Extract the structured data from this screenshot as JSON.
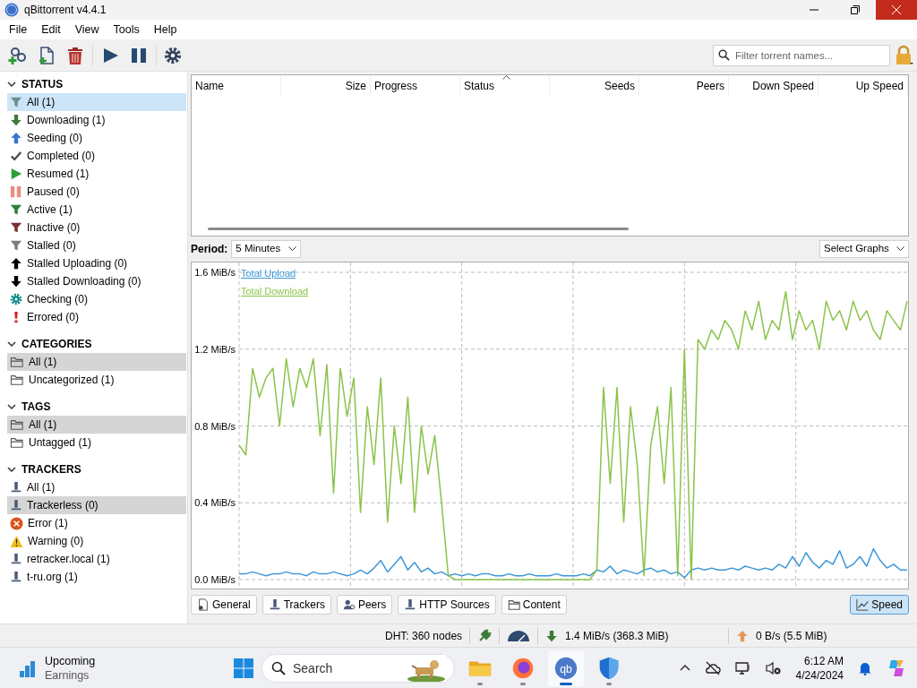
{
  "window": {
    "title": "qBittorrent v4.4.1",
    "close_hovered": true
  },
  "menu": [
    "File",
    "Edit",
    "View",
    "Tools",
    "Help"
  ],
  "filter": {
    "placeholder": "Filter torrent names..."
  },
  "sidebar": [
    {
      "title": "STATUS",
      "expanded": true,
      "focused": true,
      "items": [
        {
          "kind": "all",
          "label": "All (1)",
          "selected": true
        },
        {
          "kind": "downloading",
          "label": "Downloading (1)",
          "selected": false
        },
        {
          "kind": "seeding",
          "label": "Seeding (0)",
          "selected": false
        },
        {
          "kind": "completed",
          "label": "Completed (0)",
          "selected": false
        },
        {
          "kind": "resumed",
          "label": "Resumed (1)",
          "selected": false
        },
        {
          "kind": "paused",
          "label": "Paused (0)",
          "selected": false
        },
        {
          "kind": "active",
          "label": "Active (1)",
          "selected": false
        },
        {
          "kind": "inactive",
          "label": "Inactive (0)",
          "selected": false
        },
        {
          "kind": "stalled",
          "label": "Stalled (0)",
          "selected": false
        },
        {
          "kind": "stalled-up",
          "label": "Stalled Uploading (0)",
          "selected": false
        },
        {
          "kind": "stalled-down",
          "label": "Stalled Downloading (0)",
          "selected": false
        },
        {
          "kind": "checking",
          "label": "Checking (0)",
          "selected": false
        },
        {
          "kind": "errored",
          "label": "Errored (0)",
          "selected": false
        }
      ]
    },
    {
      "title": "CATEGORIES",
      "expanded": true,
      "focused": false,
      "items": [
        {
          "kind": "folder",
          "label": "All (1)",
          "selected": true
        },
        {
          "kind": "folder",
          "label": "Uncategorized (1)",
          "selected": false
        }
      ]
    },
    {
      "title": "TAGS",
      "expanded": true,
      "focused": false,
      "items": [
        {
          "kind": "folder",
          "label": "All (1)",
          "selected": true
        },
        {
          "kind": "folder",
          "label": "Untagged (1)",
          "selected": false
        }
      ]
    },
    {
      "title": "TRACKERS",
      "expanded": true,
      "focused": false,
      "items": [
        {
          "kind": "tracker",
          "label": "All (1)",
          "selected": false
        },
        {
          "kind": "tracker",
          "label": "Trackerless (0)",
          "selected": true
        },
        {
          "kind": "error",
          "label": "Error (1)",
          "selected": false
        },
        {
          "kind": "warning",
          "label": "Warning (0)",
          "selected": false
        },
        {
          "kind": "tracker",
          "label": "retracker.local (1)",
          "selected": false
        },
        {
          "kind": "tracker",
          "label": "t-ru.org (1)",
          "selected": false
        }
      ]
    }
  ],
  "table": {
    "columns": [
      {
        "label": "Name",
        "sorted": false
      },
      {
        "label": "Size",
        "sorted": false
      },
      {
        "label": "Progress",
        "sorted": false
      },
      {
        "label": "Status",
        "sorted": true
      },
      {
        "label": "Seeds",
        "sorted": false
      },
      {
        "label": "Peers",
        "sorted": false
      },
      {
        "label": "Down Speed",
        "sorted": false
      },
      {
        "label": "Up Speed",
        "sorted": false
      }
    ]
  },
  "graph": {
    "period_label": "Period:",
    "period": "5 Minutes",
    "select_graphs": "Select Graphs",
    "chart_data": {
      "type": "line",
      "grid": true,
      "ylim": [
        0,
        1.6
      ],
      "yticks": [
        {
          "value": 0,
          "label": "0.0 MiB/s"
        },
        {
          "value": 0.4,
          "label": "0.4 MiB/s"
        },
        {
          "value": 0.8,
          "label": "0.8 MiB/s"
        },
        {
          "value": 1.2,
          "label": "1.2 MiB/s"
        },
        {
          "value": 1.6,
          "label": "1.6 MiB/s"
        }
      ],
      "series": [
        {
          "name": "Total Upload",
          "color": "#3d97d8",
          "values": [
            0.03,
            0.03,
            0.04,
            0.03,
            0.02,
            0.03,
            0.03,
            0.04,
            0.03,
            0.03,
            0.02,
            0.04,
            0.03,
            0.03,
            0.04,
            0.03,
            0.02,
            0.03,
            0.05,
            0.03,
            0.06,
            0.1,
            0.04,
            0.08,
            0.12,
            0.05,
            0.09,
            0.04,
            0.06,
            0.03,
            0.04,
            0.02,
            0.03,
            0.02,
            0.03,
            0.02,
            0.03,
            0.03,
            0.02,
            0.02,
            0.03,
            0.02,
            0.02,
            0.03,
            0.02,
            0.02,
            0.02,
            0.03,
            0.02,
            0.02,
            0.02,
            0.03,
            0.02,
            0.05,
            0.04,
            0.07,
            0.03,
            0.05,
            0.04,
            0.03,
            0.05,
            0.06,
            0.04,
            0.05,
            0.03,
            0.04,
            0.01,
            0.05,
            0.06,
            0.05,
            0.06,
            0.05,
            0.05,
            0.06,
            0.05,
            0.07,
            0.06,
            0.05,
            0.06,
            0.05,
            0.08,
            0.06,
            0.12,
            0.07,
            0.14,
            0.09,
            0.06,
            0.1,
            0.08,
            0.15,
            0.06,
            0.08,
            0.12,
            0.07,
            0.16,
            0.1,
            0.06,
            0.08,
            0.05,
            0.05
          ]
        },
        {
          "name": "Total Download",
          "color": "#8bc34a",
          "values": [
            0.7,
            0.65,
            1.1,
            0.95,
            1.05,
            1.1,
            0.8,
            1.15,
            0.9,
            1.1,
            1.0,
            1.15,
            0.75,
            1.12,
            0.45,
            1.1,
            0.85,
            1.05,
            0.35,
            0.9,
            0.6,
            1.05,
            0.3,
            0.8,
            0.5,
            0.95,
            0.35,
            0.8,
            0.55,
            0.75,
            0.4,
            0.02,
            0,
            0,
            0,
            0,
            0,
            0,
            0,
            0,
            0,
            0,
            0,
            0,
            0,
            0,
            0,
            0,
            0,
            0,
            0,
            0,
            0,
            0.05,
            1.0,
            0.5,
            1.0,
            0.3,
            0.9,
            0.6,
            0.02,
            0.7,
            0.9,
            0.5,
            1.0,
            0.02,
            1.2,
            0.0,
            1.25,
            1.2,
            1.3,
            1.25,
            1.35,
            1.3,
            1.2,
            1.4,
            1.3,
            1.45,
            1.25,
            1.35,
            1.3,
            1.5,
            1.25,
            1.4,
            1.3,
            1.35,
            1.2,
            1.45,
            1.35,
            1.4,
            1.3,
            1.45,
            1.35,
            1.4,
            1.3,
            1.25,
            1.4,
            1.35,
            1.3,
            1.45
          ]
        }
      ]
    }
  },
  "detail_tabs": [
    {
      "kind": "general",
      "label": "General",
      "selected": false
    },
    {
      "kind": "trackers",
      "label": "Trackers",
      "selected": false
    },
    {
      "kind": "peers",
      "label": "Peers",
      "selected": false
    },
    {
      "kind": "http",
      "label": "HTTP Sources",
      "selected": false
    },
    {
      "kind": "content",
      "label": "Content",
      "selected": false
    },
    {
      "kind": "speed",
      "label": "Speed",
      "selected": true
    }
  ],
  "status_bar": {
    "dht": "DHT: 360 nodes",
    "download": "1.4 MiB/s (368.3 MiB)",
    "upload": "0 B/s (5.5 MiB)"
  },
  "taskbar": {
    "widget": {
      "title": "Upcoming",
      "subtitle": "Earnings"
    },
    "search_placeholder": "Search",
    "apps": [
      {
        "kind": "explorer",
        "selected": false
      },
      {
        "kind": "firefox",
        "selected": false
      },
      {
        "kind": "qbittorrent",
        "label": "qb",
        "selected": true
      },
      {
        "kind": "defender",
        "selected": false
      }
    ],
    "time": "6:12 AM",
    "date": "4/24/2024"
  }
}
